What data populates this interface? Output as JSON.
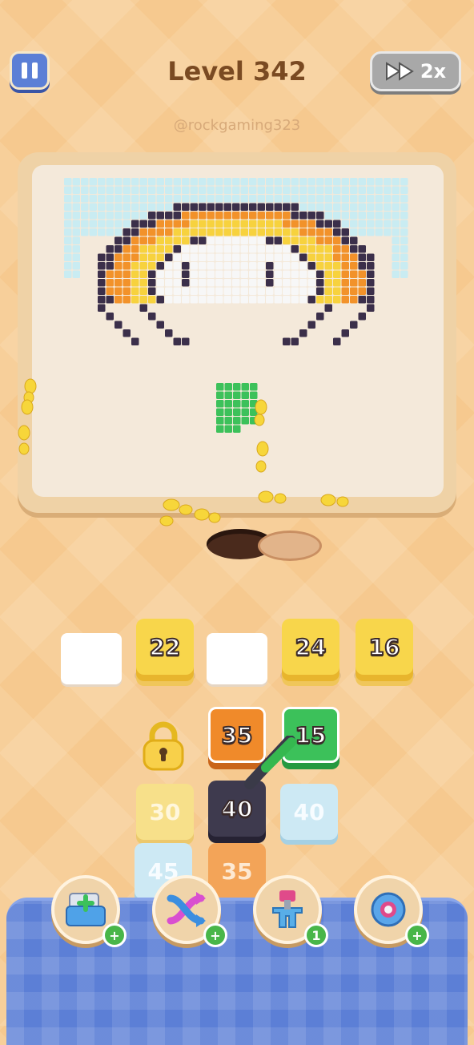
{
  "header": {
    "pause_label": "pause",
    "level_title": "Level 342",
    "speed_label": "2x",
    "watermark": "@rockgaming323"
  },
  "slots": [
    {
      "type": "empty"
    },
    {
      "type": "tile",
      "value": "22",
      "color": "yellow"
    },
    {
      "type": "empty"
    },
    {
      "type": "tile",
      "value": "24",
      "color": "yellow"
    },
    {
      "type": "tile",
      "value": "16",
      "color": "yellow"
    }
  ],
  "grid": {
    "row1": [
      "35",
      "15"
    ],
    "row2": [
      "30",
      "40",
      "40"
    ],
    "row3": [
      "45",
      "35"
    ]
  },
  "powerups": [
    {
      "icon": "add-tray-icon",
      "badge": "+"
    },
    {
      "icon": "shuffle-icon",
      "badge": "+"
    },
    {
      "icon": "magnet-icon",
      "badge": "1"
    },
    {
      "icon": "ring-icon",
      "badge": "+"
    }
  ],
  "colors": {
    "background": "#f6c98f",
    "tray": "#5c7fd6",
    "yellow": "#f8d64b",
    "orange": "#f08a2a",
    "green": "#3cc15a",
    "dark": "#3e3a4e",
    "pixel_blue": "#c9ecf2",
    "pixel_orange": "#f2922a",
    "pixel_yellow": "#f7d23e",
    "pixel_dark": "#3b2f4a"
  }
}
